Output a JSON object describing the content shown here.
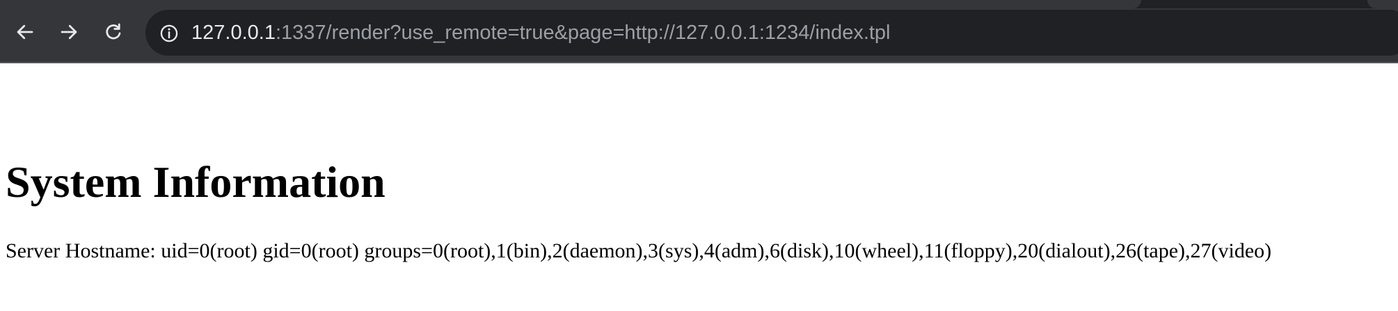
{
  "browser": {
    "url_host": "127.0.0.1",
    "url_rest": ":1337/render?use_remote=true&page=http://127.0.0.1:1234/index.tpl",
    "icons": {
      "back": "arrow-left-icon",
      "forward": "arrow-right-icon",
      "reload": "reload-icon",
      "site_info": "info-icon"
    },
    "colors": {
      "toolbar": "#35363a",
      "omnibox": "#202124",
      "url_host_text": "#e8eaed",
      "url_rest_text": "#9aa0a6",
      "icon": "#e8eaed"
    }
  },
  "page": {
    "title": "System Information",
    "info_line": "Server Hostname: uid=0(root) gid=0(root) groups=0(root),1(bin),2(daemon),3(sys),4(adm),6(disk),10(wheel),11(floppy),20(dialout),26(tape),27(video)"
  }
}
